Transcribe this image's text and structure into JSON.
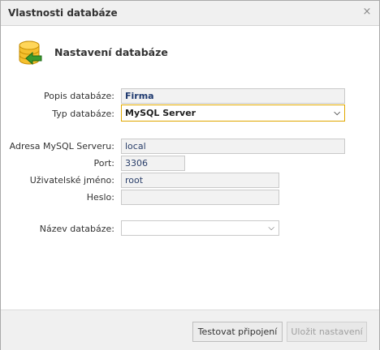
{
  "dialog": {
    "title": "Vlastnosti databáze",
    "close_glyph": "×"
  },
  "header": {
    "icon": "database-icon",
    "title": "Nastavení databáze"
  },
  "form": {
    "description_label": "Popis databáze:",
    "description_value": "Firma",
    "type_label": "Typ databáze:",
    "type_value": "MySQL Server",
    "address_label": "Adresa MySQL Serveru:",
    "address_value": "local",
    "port_label": "Port:",
    "port_value": "3306",
    "username_label": "Uživatelské jméno:",
    "username_value": "root",
    "password_label": "Heslo:",
    "password_value": "",
    "dbname_label": "Název databáze:",
    "dbname_value": ""
  },
  "buttons": {
    "test_label": "Testovat připojení",
    "save_label": "Uložit nastavení"
  },
  "colors": {
    "focus_border": "#e0a800",
    "field_text": "#1f3a70"
  }
}
